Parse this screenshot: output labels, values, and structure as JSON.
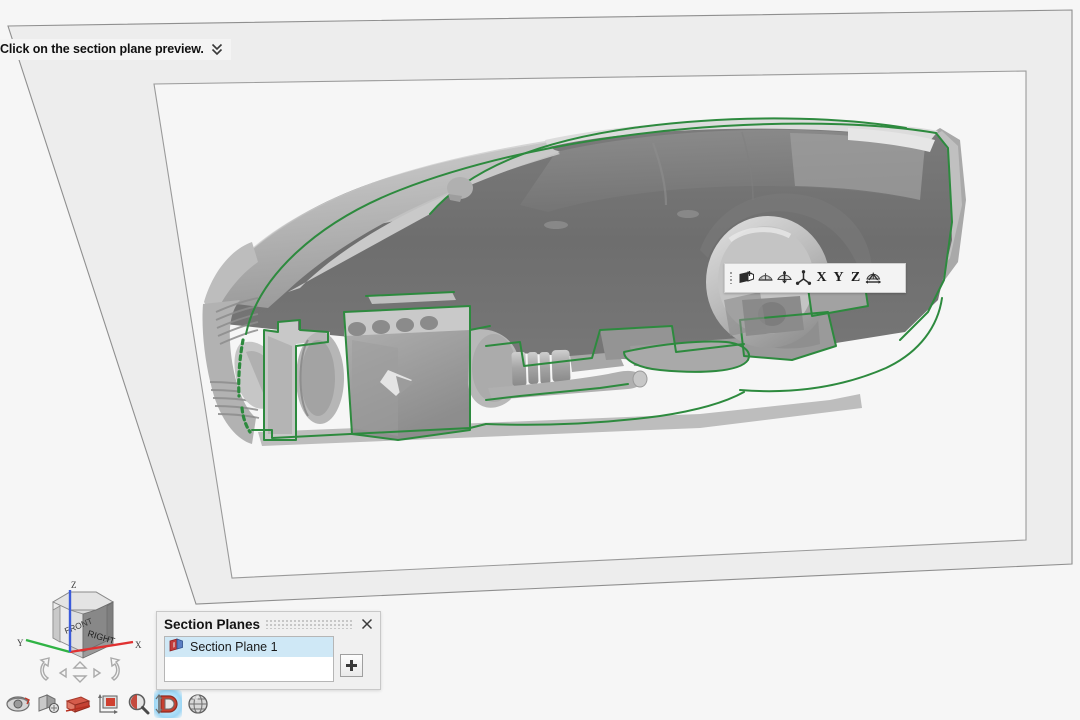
{
  "app": {
    "title": "SketchUp 3D model viewport",
    "background_color": "#f6f6f6"
  },
  "status_tip": {
    "message": "Click on the section plane preview.",
    "expand_icon": "chevron-double-down-icon"
  },
  "model": {
    "description": "Station wagon car 3D model shown in cutaway / section view",
    "cut_line_color": "#2d8a3e",
    "body_light_color": "#b9b9b9",
    "body_dark_color": "#6f6f6f",
    "section_plane_fill": "#e9e9e9",
    "section_plane_edge": "#9a9a9a"
  },
  "plane_toolbar": {
    "name": "section-plane-context-toolbar",
    "grip": "drag-grip",
    "items": [
      {
        "icon": "section-plane-icon",
        "label": "Section Plane"
      },
      {
        "icon": "flip-plane-icon",
        "label": "Flip"
      },
      {
        "icon": "reverse-plane-icon",
        "label": "Reverse"
      },
      {
        "icon": "align-axes-icon",
        "label": "Align"
      }
    ],
    "axes": [
      "X",
      "Y",
      "Z"
    ],
    "end_item": {
      "icon": "move-plane-icon",
      "label": "Move"
    }
  },
  "section_planes_panel": {
    "title": "Section Planes",
    "close_label": "×",
    "add_label": "+",
    "items": [
      {
        "name": "Section Plane 1",
        "icon": "section-plane-list-icon",
        "selected": true
      }
    ]
  },
  "view_cube": {
    "faces": {
      "front": "FRONT",
      "right": "RIGHT"
    },
    "axes": [
      {
        "label": "X",
        "color": "#e03131"
      },
      {
        "label": "Y",
        "color": "#2fb344"
      },
      {
        "label": "Z",
        "color": "#3b5bdb"
      }
    ],
    "nav_icons": [
      "rotate-left-icon",
      "arrow-left-icon",
      "arrow-up-icon",
      "arrow-down-icon",
      "arrow-right-icon",
      "rotate-right-icon"
    ]
  },
  "bottom_toolbar": {
    "items": [
      {
        "icon": "orbit-icon",
        "label": "Orbit",
        "active": false
      },
      {
        "icon": "pan-icon",
        "label": "Pan",
        "active": false
      },
      {
        "icon": "section-plane-tool-icon",
        "label": "Section Plane",
        "active": false
      },
      {
        "icon": "zoom-window-icon",
        "label": "Zoom Window",
        "active": false
      },
      {
        "icon": "zoom-icon",
        "label": "Zoom",
        "active": false
      },
      {
        "icon": "zoom-extents-icon",
        "label": "Zoom Extents",
        "active": true
      },
      {
        "icon": "globe-icon",
        "label": "Previous View",
        "active": false
      }
    ]
  }
}
